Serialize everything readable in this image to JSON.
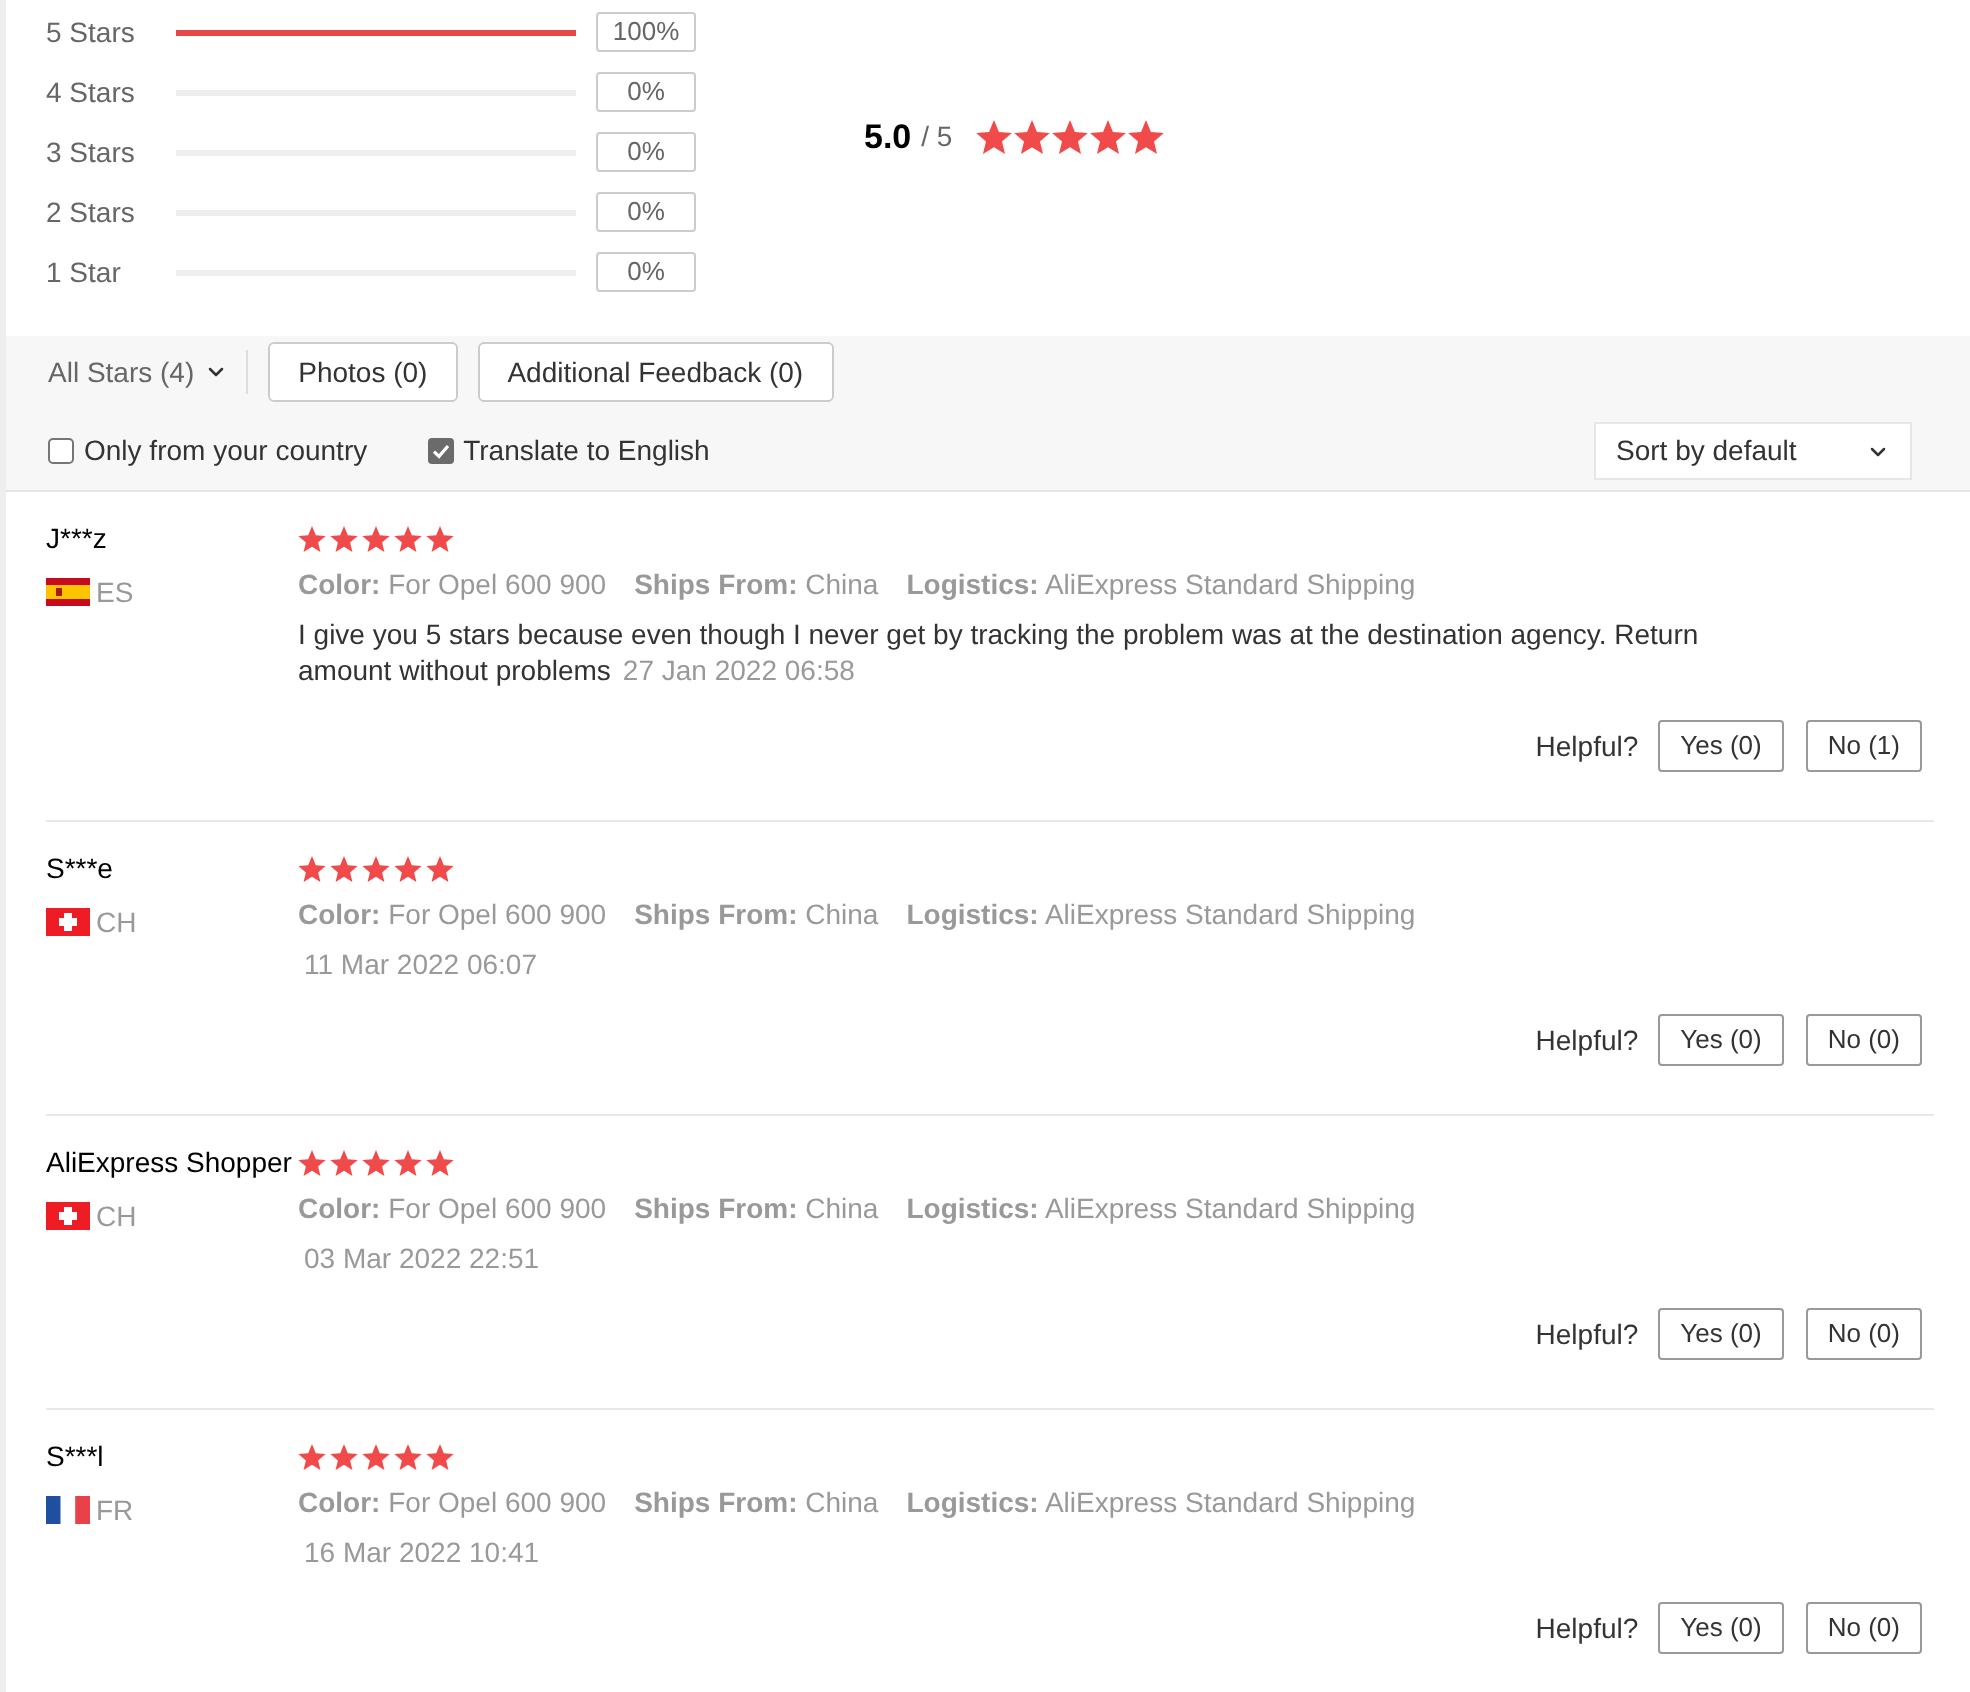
{
  "histogram": [
    {
      "label": "5 Stars",
      "level": 1,
      "percent": "100%"
    },
    {
      "label": "4 Stars",
      "level": 0,
      "percent": "0%"
    },
    {
      "label": "3 Stars",
      "level": 0,
      "percent": "0%"
    },
    {
      "label": "2 Stars",
      "level": 0,
      "percent": "0%"
    },
    {
      "label": "1 Star",
      "level": 0,
      "percent": "0%"
    }
  ],
  "summary": {
    "score": "5.0",
    "scale": "/ 5",
    "stars": 5
  },
  "filters": {
    "star_filter": "All Stars (4)",
    "buttons": [
      "Photos (0)",
      "Additional Feedback (0)"
    ],
    "options": [
      {
        "label": "Only from your country",
        "checked": false
      },
      {
        "label": "Translate to English",
        "checked": true
      }
    ],
    "sort": "Sort by default"
  },
  "reviews": [
    {
      "name": "J***z",
      "flag": {
        "kind": "spain"
      },
      "country": "ES",
      "stars": 5,
      "attributes": [
        "**Color:** For Opel 600 900",
        "**Ships From:** China",
        "**Logistics:** AliExpress Standard Shipping"
      ],
      "text": "I give you 5 stars because even though I never get by tracking the problem was at the destination agency. Return amount without problems",
      "date": "27 Jan 2022 06:58",
      "helpful_label": "Helpful?",
      "yes": "Yes (0)",
      "no": "No (1)"
    },
    {
      "name": "S***e",
      "flag": {
        "kind": "switzerland"
      },
      "country": "CH",
      "stars": 5,
      "attributes": [
        "**Color:** For Opel 600 900",
        "**Ships From:** China",
        "**Logistics:** AliExpress Standard Shipping"
      ],
      "date": "11 Mar 2022 06:07",
      "helpful_label": "Helpful?",
      "yes": "Yes (0)",
      "no": "No (0)"
    },
    {
      "name": "AliExpress Shopper",
      "flag": {
        "kind": "switzerland"
      },
      "country": "CH",
      "stars": 5,
      "attributes": [
        "**Color:** For Opel 600 900",
        "**Ships From:** China",
        "**Logistics:** AliExpress Standard Shipping"
      ],
      "date": "03 Mar 2022 22:51",
      "helpful_label": "Helpful?",
      "yes": "Yes (0)",
      "no": "No (0)"
    },
    {
      "name": "S***l",
      "flag": {
        "kind": "france"
      },
      "country": "FR",
      "stars": 5,
      "attributes": [
        "**Color:** For Opel 600 900",
        "**Ships From:** China",
        "**Logistics:** AliExpress Standard Shipping"
      ],
      "date": "16 Mar 2022 10:41",
      "helpful_label": "Helpful?",
      "yes": "Yes (0)",
      "no": "No (0)"
    }
  ]
}
